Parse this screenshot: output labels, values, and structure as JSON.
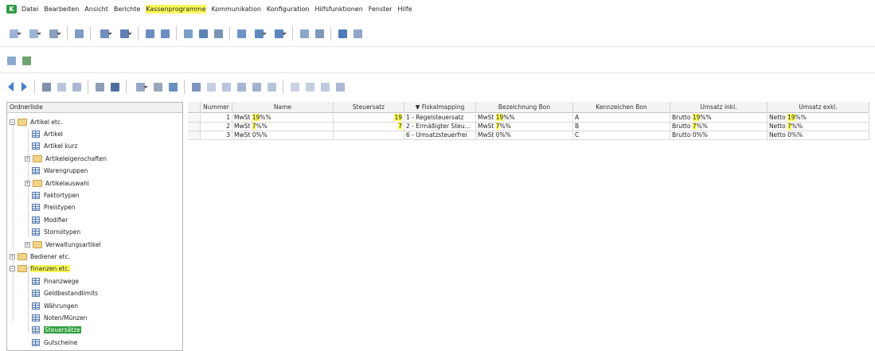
{
  "menu": {
    "logo": "K",
    "items": [
      {
        "label": "Datei",
        "hl": false
      },
      {
        "label": "Bearbeiten",
        "hl": false
      },
      {
        "label": "Ansicht",
        "hl": false
      },
      {
        "label": "Berichte",
        "hl": false
      },
      {
        "label": "Kassenprogramme",
        "hl": true
      },
      {
        "label": "Kommunikation",
        "hl": false
      },
      {
        "label": "Konfiguration",
        "hl": false
      },
      {
        "label": "Hilfsfunktionen",
        "hl": false
      },
      {
        "label": "Fenster",
        "hl": false
      },
      {
        "label": "Hilfe",
        "hl": false
      }
    ]
  },
  "tree": {
    "title": "Ordnerliste",
    "items": [
      {
        "label": "Artikel etc.",
        "type": "folder",
        "level": 0,
        "expander": "−"
      },
      {
        "label": "Artikel",
        "type": "grid",
        "level": 1
      },
      {
        "label": "Artikel kurz",
        "type": "grid",
        "level": 1
      },
      {
        "label": "Artikeleigenschaften",
        "type": "folder",
        "level": 1,
        "expander": "+"
      },
      {
        "label": "Warengruppen",
        "type": "grid",
        "level": 1
      },
      {
        "label": "Artikelauswahl",
        "type": "folder",
        "level": 1,
        "expander": "+"
      },
      {
        "label": "Faktortypen",
        "type": "grid",
        "level": 1
      },
      {
        "label": "Preistypen",
        "type": "grid",
        "level": 1
      },
      {
        "label": "Modifier",
        "type": "grid",
        "level": 1
      },
      {
        "label": "Stornotypen",
        "type": "grid",
        "level": 1
      },
      {
        "label": "Verwaltungsartikel",
        "type": "folder",
        "level": 1,
        "expander": "+"
      },
      {
        "label": "Bediener etc.",
        "type": "folder",
        "level": 0,
        "expander": "+"
      },
      {
        "label": "Finanzen etc.",
        "type": "folder",
        "level": 0,
        "expander": "−",
        "hl": true
      },
      {
        "label": "Finanzwege",
        "type": "grid",
        "level": 1
      },
      {
        "label": "Geldbestandlimits",
        "type": "grid",
        "level": 1
      },
      {
        "label": "Währungen",
        "type": "grid",
        "level": 1
      },
      {
        "label": "Noten/Münzen",
        "type": "grid",
        "level": 1
      },
      {
        "label": "Steuersätze",
        "type": "grid",
        "level": 1,
        "selected": true
      },
      {
        "label": "Gutscheine",
        "type": "grid",
        "level": 1
      }
    ]
  },
  "table": {
    "columns": [
      {
        "label": "Nummer",
        "w": 40
      },
      {
        "label": "Name",
        "w": 127
      },
      {
        "label": "Steuersatz",
        "w": 89
      },
      {
        "label": "▼  Fiskalmapping",
        "w": 90
      },
      {
        "label": "Bezeichnung Bon",
        "w": 122
      },
      {
        "label": "Kennzeichen Bon",
        "w": 122
      },
      {
        "label": "Umsatz inkl.",
        "w": 122
      },
      {
        "label": "Umsatz exkl.",
        "w": 128
      }
    ],
    "rows": [
      {
        "nummer": "1",
        "name": {
          "pre": "MwSt ",
          "mark": "19",
          "post": "%%"
        },
        "steuersatz": "19",
        "steuersatz_mark": true,
        "fiskal": "1 - Regelsteuersatz",
        "bezeichnung": {
          "pre": "MwSt ",
          "mark": "19",
          "post": "%%"
        },
        "kennzeichen": "A",
        "inkl": {
          "pre": "Brutto ",
          "mark": "19",
          "post": "%%"
        },
        "exkl": {
          "pre": "Netto ",
          "mark": "19",
          "post": "%%"
        }
      },
      {
        "nummer": "2",
        "name": {
          "pre": "MwSt ",
          "mark": "7",
          "post": "%%"
        },
        "steuersatz": "7",
        "steuersatz_mark": true,
        "fiskal": "2 - Ermäßigter Steu...",
        "bezeichnung": {
          "pre": "MwSt ",
          "mark": "7",
          "post": "%%"
        },
        "kennzeichen": "B",
        "inkl": {
          "pre": "Brutto ",
          "mark": "7",
          "post": "%%"
        },
        "exkl": {
          "pre": "Netto ",
          "mark": "7",
          "post": "%%"
        }
      },
      {
        "nummer": "3",
        "name": {
          "pre": "MwSt 0%%",
          "mark": "",
          "post": ""
        },
        "steuersatz": "",
        "steuersatz_mark": false,
        "fiskal": "6 - Umsatzsteuerfrei",
        "bezeichnung": {
          "pre": "MwSt 0%%",
          "mark": "",
          "post": ""
        },
        "kennzeichen": "C",
        "inkl": {
          "pre": "Brutto 0%%",
          "mark": "",
          "post": ""
        },
        "exkl": {
          "pre": "Netto 0%%",
          "mark": "",
          "post": ""
        }
      }
    ]
  },
  "colors": {
    "highlight": "#ffff5a",
    "selected": "#2e9e3e"
  }
}
